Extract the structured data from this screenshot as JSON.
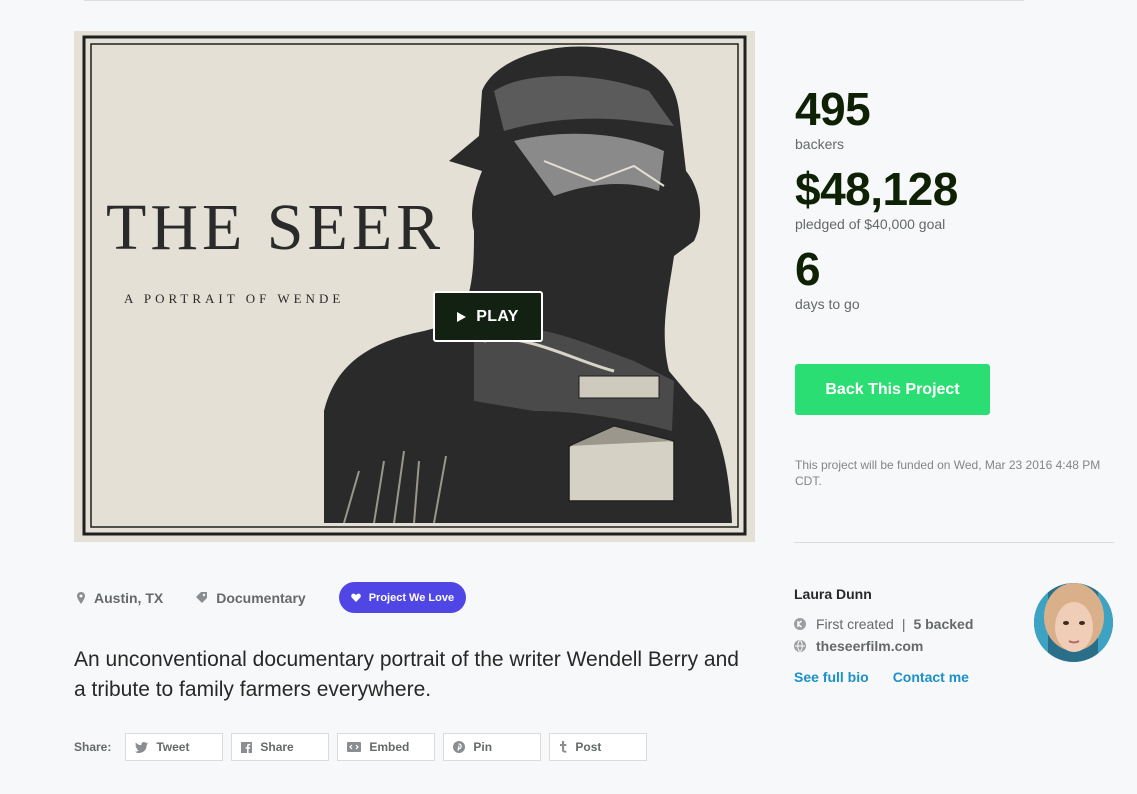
{
  "video": {
    "title_line": "THE SEER",
    "subtitle_line": "A PORTRAIT OF WENDE",
    "play_label": "PLAY"
  },
  "stats": {
    "backers": {
      "value": "495",
      "label": "backers"
    },
    "pledged": {
      "value": "$48,128",
      "label": "pledged of $40,000 goal"
    },
    "days": {
      "value": "6",
      "label": "days to go"
    }
  },
  "back_button": "Back This Project",
  "funding_note": "This project will be funded on Wed, Mar 23 2016 4:48 PM CDT.",
  "creator": {
    "name": "Laura Dunn",
    "first_created": "First created",
    "backed": "5 backed",
    "website": "theseerfilm.com",
    "see_bio": "See full bio",
    "contact": "Contact me"
  },
  "meta": {
    "location": "Austin, TX",
    "category": "Documentary",
    "badge": "Project We Love"
  },
  "blurb": "An unconventional documentary portrait of the writer Wendell Berry and a tribute to family farmers everywhere.",
  "share": {
    "label": "Share:",
    "buttons": [
      {
        "label": "Tweet",
        "icon": "twitter-icon"
      },
      {
        "label": "Share",
        "icon": "facebook-icon"
      },
      {
        "label": "Embed",
        "icon": "embed-icon"
      },
      {
        "label": "Pin",
        "icon": "pinterest-icon"
      },
      {
        "label": "Post",
        "icon": "tumblr-icon"
      }
    ]
  },
  "colors": {
    "accent_green": "#2bde73",
    "stat_dark": "#0f2105",
    "badge_purple": "#5046e5",
    "link_blue": "#1b91c9"
  }
}
